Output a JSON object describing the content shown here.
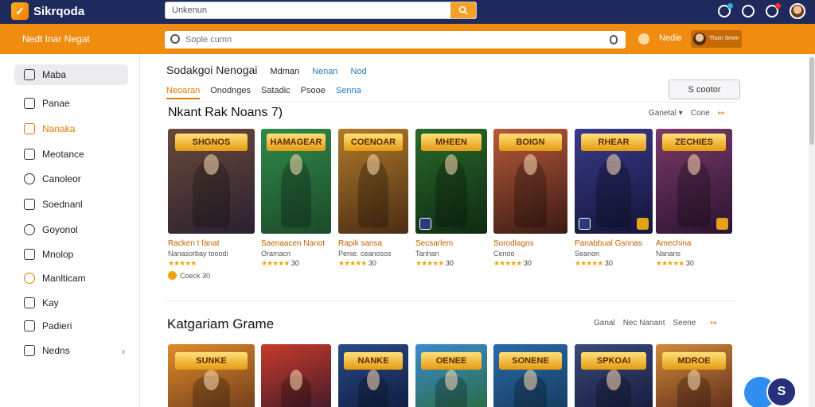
{
  "topbar": {
    "logo_text": "Sikrqoda",
    "search_value": "Unkenun"
  },
  "orangebar": {
    "title": "Nedt Inar Negat",
    "search_placeholder": "Sople cumn",
    "home_label": "Nedie",
    "user_label": "Thoin Smen"
  },
  "sidebar": {
    "items": [
      {
        "label": "Maba",
        "icon": "home-icon"
      },
      {
        "label": "Panae",
        "icon": "pen-icon"
      },
      {
        "label": "Nanaka",
        "icon": "grid-icon"
      },
      {
        "label": "Meotance",
        "icon": "window-icon"
      },
      {
        "label": "Canoleor",
        "icon": "clock-icon"
      },
      {
        "label": "Soednanl",
        "icon": "tag-icon"
      },
      {
        "label": "Goyonol",
        "icon": "chat-icon"
      },
      {
        "label": "Mnolop",
        "icon": "bookmark-icon"
      },
      {
        "label": "Manlticam",
        "icon": "compass-icon"
      },
      {
        "label": "Kay",
        "icon": "key-icon"
      },
      {
        "label": "Padieri",
        "icon": "list-icon"
      },
      {
        "label": "Nedns",
        "icon": "folder-icon"
      }
    ]
  },
  "main": {
    "title": "Sodakgoi Nenogai",
    "title_links": [
      "Mdman",
      "Nenan",
      "Nod"
    ],
    "tabs": [
      "Neoaran",
      "Onodnges",
      "Satadic",
      "Psooe",
      "Senna"
    ],
    "right_button": "S cootor",
    "section1": {
      "title": "Nkant Rak Noans 7)",
      "tools": [
        "Ganetal",
        "Cone"
      ]
    },
    "section2": {
      "title": "Katgariam Grame",
      "tools": [
        "Ganal",
        "Nec Nanant",
        "Seene"
      ]
    },
    "cards": [
      {
        "banner": "SHGNOS",
        "title": "Racken t fanat",
        "sub": "Nanasorbay tooodi",
        "rating": "",
        "extra": "Coeck 30",
        "colors": [
          "#6a4a3a",
          "#2a2030"
        ]
      },
      {
        "banner": "HAMAGEAR",
        "title": "Saenaacen Nanot",
        "sub": "Oramacn",
        "rating": "30",
        "extra": "",
        "colors": [
          "#2f8a4a",
          "#1c4a2a"
        ]
      },
      {
        "banner": "COENOAR",
        "title": "Rapik sansa",
        "sub": "Penie. ceanosos",
        "rating": "30",
        "extra": "",
        "colors": [
          "#b07a2a",
          "#4a2c14"
        ]
      },
      {
        "banner": "MHEEN",
        "title": "Secsarlem",
        "sub": "Tanhan",
        "rating": "30",
        "extra": "",
        "colors": [
          "#2a6a2a",
          "#0e2a12"
        ]
      },
      {
        "banner": "BOIGN",
        "title": "Sorodlagns",
        "sub": "Cenoo",
        "rating": "30",
        "extra": "",
        "colors": [
          "#b85a3a",
          "#3a1a14"
        ]
      },
      {
        "banner": "RHEAR",
        "title": "Panabbual Gsnnas",
        "sub": "Seanon",
        "rating": "30",
        "extra": "",
        "colors": [
          "#3a3a8a",
          "#14143a"
        ]
      },
      {
        "banner": "ZECHIES",
        "title": "Amechina",
        "sub": "Nanans",
        "rating": "30",
        "extra": "",
        "colors": [
          "#7a3a6a",
          "#2a1430"
        ]
      }
    ],
    "cards2": [
      {
        "banner": "SUNKE",
        "colors": [
          "#e08a2a",
          "#6a3a1a"
        ]
      },
      {
        "banner": "",
        "colors": [
          "#c83a2a",
          "#3a1a2a"
        ]
      },
      {
        "banner": "NANKE",
        "colors": [
          "#2a4a8a",
          "#0e1a3a"
        ]
      },
      {
        "banner": "OENEE",
        "colors": [
          "#3a8ad0",
          "#2a6a3a"
        ]
      },
      {
        "banner": "SONENE",
        "colors": [
          "#2a6aaa",
          "#143a5a"
        ]
      },
      {
        "banner": "SPKOAI",
        "colors": [
          "#3a4a7a",
          "#141a3a"
        ]
      },
      {
        "banner": "MDROE",
        "colors": [
          "#d08a3a",
          "#5a2a1a"
        ]
      }
    ]
  },
  "accent": "#f08c10"
}
